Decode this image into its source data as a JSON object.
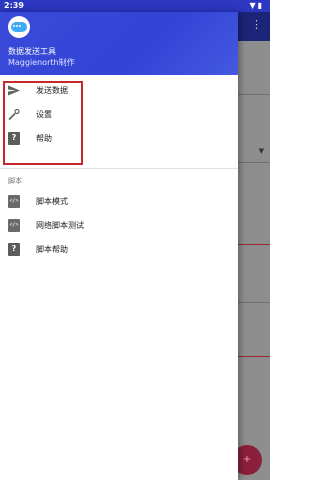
{
  "status_bar": {
    "time": "2:39",
    "icons": [
      "wifi-icon",
      "battery-icon"
    ]
  },
  "background_app": {
    "menu_icon": "overflow-menu-icon",
    "fab_icon": "plus-icon"
  },
  "drawer": {
    "header": {
      "app_name": "数据发送工具",
      "author": "Maggienorth制作"
    },
    "menu_items": [
      {
        "label": "发送数据",
        "icon": "send-icon"
      },
      {
        "label": "设置",
        "icon": "wrench-icon"
      },
      {
        "label": "帮助",
        "icon": "help-icon"
      }
    ],
    "script_section": {
      "header": "脚本",
      "items": [
        {
          "label": "脚本模式",
          "icon": "script-file-icon"
        },
        {
          "label": "网络脚本测试",
          "icon": "script-file-icon"
        },
        {
          "label": "脚本帮助",
          "icon": "help-icon"
        }
      ]
    }
  },
  "colors": {
    "accent": "#3344d6",
    "status_bar": "#2c37c2",
    "highlight": "#c6282c"
  }
}
